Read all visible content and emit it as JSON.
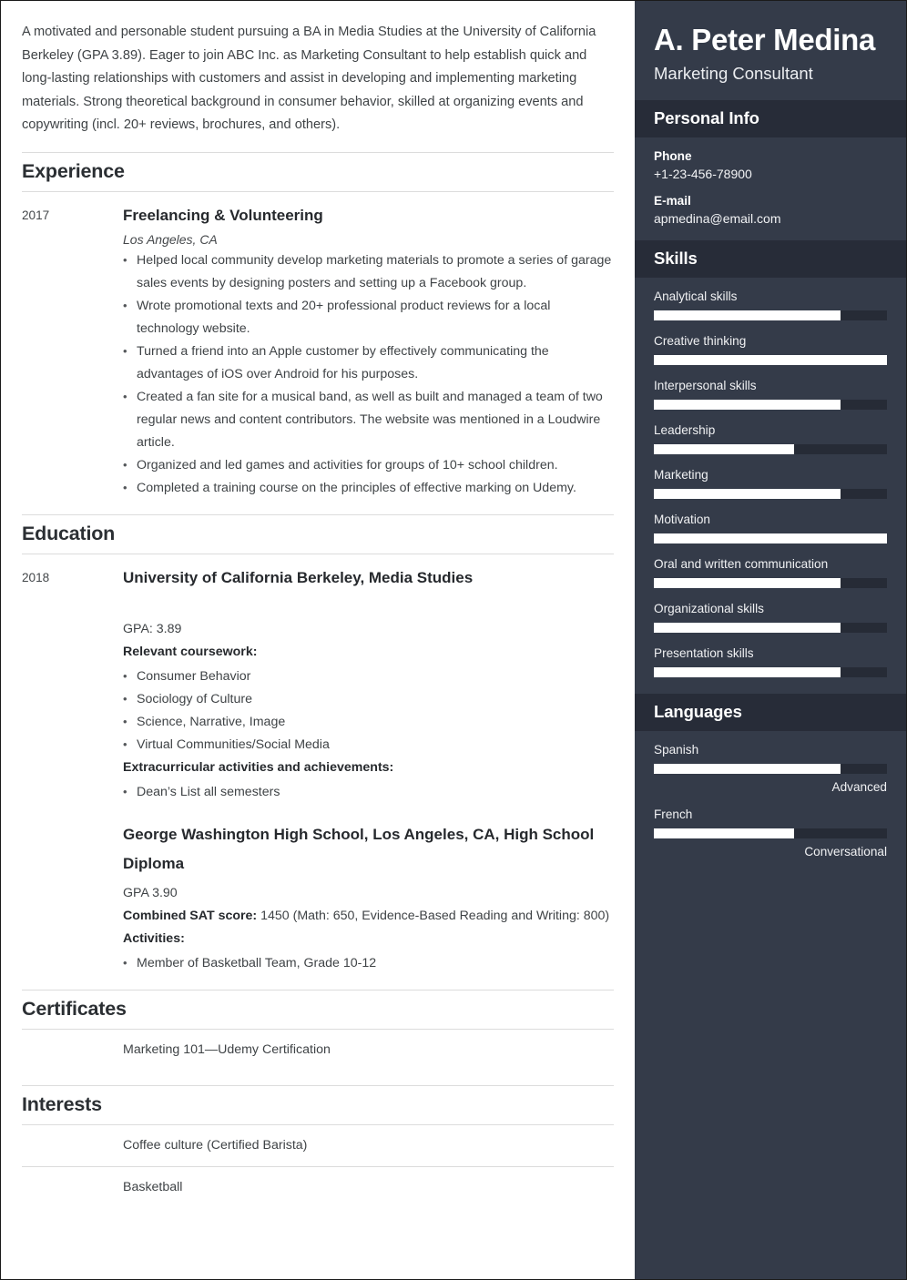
{
  "summary": "A motivated and personable student pursuing a BA in Media Studies at the University of California Berkeley (GPA 3.89). Eager to join ABC Inc. as Marketing Consultant to help establish quick and long-lasting relationships with customers and assist in developing and implementing marketing materials. Strong theoretical background in consumer behavior, skilled at organizing events and copywriting (incl. 20+ reviews, brochures, and others).",
  "sections": {
    "experience": {
      "title": "Experience",
      "entry": {
        "date": "2017",
        "title": "Freelancing & Volunteering",
        "location": "Los Angeles, CA",
        "bullets": [
          "Helped local community develop marketing materials to promote a series of garage sales events by designing posters and setting up a Facebook group.",
          "Wrote promotional texts and 20+ professional product reviews for a local technology website.",
          "Turned a friend into an Apple customer by effectively communicating the advantages of iOS over Android for his purposes.",
          "Created a fan site for a musical band, as well as built and managed a team of two regular news and content contributors. The website was mentioned in a Loudwire article.",
          "Organized and led games and activities for groups of 10+ school children.",
          "Completed a training course on the principles of effective marking on Udemy."
        ]
      }
    },
    "education": {
      "title": "Education",
      "university": {
        "date": "2018",
        "title": "University of California Berkeley, Media Studies",
        "gpa": "GPA: 3.89",
        "coursework_label": "Relevant coursework:",
        "coursework": [
          "Consumer Behavior",
          "Sociology of Culture",
          "Science, Narrative, Image",
          "Virtual Communities/Social Media"
        ],
        "extracurricular_label": "Extracurricular activities and achievements:",
        "extracurricular": [
          "Dean’s List all semesters"
        ]
      },
      "highschool": {
        "title": "George Washington High School, Los Angeles, CA, High School Diploma",
        "gpa": "GPA 3.90",
        "sat_label": "Combined SAT score:",
        "sat_value": " 1450 (Math: 650, Evidence-Based Reading and Writing: 800)",
        "activities_label": "Activities:",
        "activities": [
          "Member of Basketball Team, Grade 10-12"
        ]
      }
    },
    "certificates": {
      "title": "Certificates",
      "items": [
        "Marketing 101—Udemy Certification"
      ]
    },
    "interests": {
      "title": "Interests",
      "items": [
        "Coffee culture (Certified Barista)",
        "Basketball"
      ]
    }
  },
  "sidebar": {
    "name": "A. Peter Medina",
    "job_title": "Marketing Consultant",
    "personal_info": {
      "title": "Personal Info",
      "phone_label": "Phone",
      "phone_value": "+1-23-456-78900",
      "email_label": "E-mail",
      "email_value": "apmedina@email.com"
    },
    "skills": {
      "title": "Skills",
      "items": [
        {
          "name": "Analytical skills",
          "level": 80
        },
        {
          "name": "Creative thinking",
          "level": 100
        },
        {
          "name": "Interpersonal skills",
          "level": 80
        },
        {
          "name": "Leadership",
          "level": 60
        },
        {
          "name": "Marketing",
          "level": 80
        },
        {
          "name": "Motivation",
          "level": 100
        },
        {
          "name": "Oral and written communication",
          "level": 80
        },
        {
          "name": "Organizational skills",
          "level": 80
        },
        {
          "name": "Presentation skills",
          "level": 80
        }
      ]
    },
    "languages": {
      "title": "Languages",
      "items": [
        {
          "name": "Spanish",
          "level": 80,
          "label": "Advanced"
        },
        {
          "name": "French",
          "level": 60,
          "label": "Conversational"
        }
      ]
    }
  },
  "colors": {
    "sidebar_bg": "#343b49",
    "sidebar_band_bg": "#272c38",
    "bar_track": "#262b36",
    "bar_fill": "#ffffff",
    "text_dark": "#26292d",
    "rule": "#dcdcdc"
  }
}
